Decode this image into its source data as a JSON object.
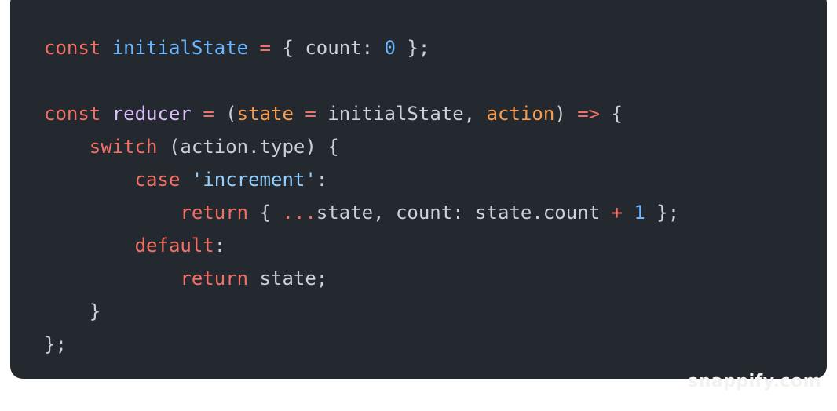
{
  "code_lines": [
    [
      {
        "t": "const",
        "c": "kw"
      },
      {
        "t": " ",
        "c": "plain"
      },
      {
        "t": "initialState",
        "c": "fn"
      },
      {
        "t": " ",
        "c": "plain"
      },
      {
        "t": "=",
        "c": "op"
      },
      {
        "t": " { count: ",
        "c": "plain"
      },
      {
        "t": "0",
        "c": "num"
      },
      {
        "t": " };",
        "c": "plain"
      }
    ],
    [],
    [
      {
        "t": "const",
        "c": "kw"
      },
      {
        "t": " ",
        "c": "plain"
      },
      {
        "t": "reducer",
        "c": "fn2"
      },
      {
        "t": " ",
        "c": "plain"
      },
      {
        "t": "=",
        "c": "op"
      },
      {
        "t": " (",
        "c": "plain"
      },
      {
        "t": "state",
        "c": "param"
      },
      {
        "t": " ",
        "c": "plain"
      },
      {
        "t": "=",
        "c": "op"
      },
      {
        "t": " initialState, ",
        "c": "plain"
      },
      {
        "t": "action",
        "c": "param"
      },
      {
        "t": ") ",
        "c": "plain"
      },
      {
        "t": "=>",
        "c": "op"
      },
      {
        "t": " {",
        "c": "plain"
      }
    ],
    [
      {
        "t": "    ",
        "c": "plain"
      },
      {
        "t": "switch",
        "c": "kw"
      },
      {
        "t": " (action.type) {",
        "c": "plain"
      }
    ],
    [
      {
        "t": "        ",
        "c": "plain"
      },
      {
        "t": "case",
        "c": "kw"
      },
      {
        "t": " ",
        "c": "plain"
      },
      {
        "t": "'increment'",
        "c": "str"
      },
      {
        "t": ":",
        "c": "plain"
      }
    ],
    [
      {
        "t": "            ",
        "c": "plain"
      },
      {
        "t": "return",
        "c": "kw"
      },
      {
        "t": " { ",
        "c": "plain"
      },
      {
        "t": "...",
        "c": "op"
      },
      {
        "t": "state, count: state.count ",
        "c": "plain"
      },
      {
        "t": "+",
        "c": "op"
      },
      {
        "t": " ",
        "c": "plain"
      },
      {
        "t": "1",
        "c": "num"
      },
      {
        "t": " };",
        "c": "plain"
      }
    ],
    [
      {
        "t": "        ",
        "c": "plain"
      },
      {
        "t": "default",
        "c": "kw"
      },
      {
        "t": ":",
        "c": "plain"
      }
    ],
    [
      {
        "t": "            ",
        "c": "plain"
      },
      {
        "t": "return",
        "c": "kw"
      },
      {
        "t": " state;",
        "c": "plain"
      }
    ],
    [
      {
        "t": "    }",
        "c": "plain"
      }
    ],
    [
      {
        "t": "};",
        "c": "plain"
      }
    ]
  ],
  "watermark": "snappify.com",
  "colors": {
    "background": "#24292f",
    "keyword": "#f47067",
    "identifier": "#6cb6ff",
    "function": "#dcbdfb",
    "parameter": "#f69d50",
    "number": "#6cb6ff",
    "string": "#96d0ff",
    "text": "#c9d1d9"
  }
}
